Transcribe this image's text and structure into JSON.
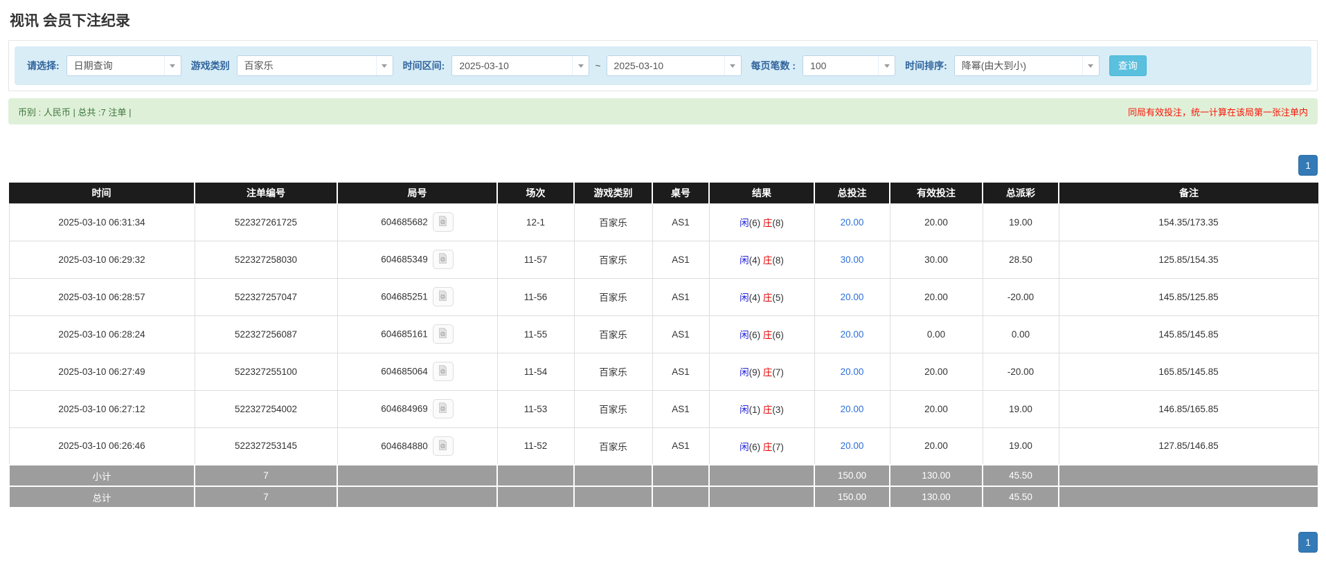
{
  "page": {
    "title": "视讯 会员下注纪录"
  },
  "filters": {
    "query_type": {
      "label": "请选择:",
      "value": "日期查询"
    },
    "game_type": {
      "label": "游戏类别",
      "value": "百家乐"
    },
    "date_range": {
      "label": "时间区间:",
      "from": "2025-03-10",
      "separator": "~",
      "to": "2025-03-10"
    },
    "page_size": {
      "label": "每页笔数 :",
      "value": "100"
    },
    "time_sort": {
      "label": "时间排序:",
      "value": "降幂(由大到小)"
    },
    "search_button": "查询"
  },
  "summary_bar": {
    "left": "币别 : 人民币 | 总共 :7 注单 |",
    "right": "同局有效投注，统一计算在该局第一张注单内"
  },
  "pagination": {
    "current_page": "1"
  },
  "table": {
    "columns": [
      {
        "key": "time",
        "label": "时间"
      },
      {
        "key": "bet_id",
        "label": "注单编号"
      },
      {
        "key": "round_id",
        "label": "局号"
      },
      {
        "key": "session",
        "label": "场次"
      },
      {
        "key": "game_type",
        "label": "游戏类别"
      },
      {
        "key": "table_id",
        "label": "桌号"
      },
      {
        "key": "result",
        "label": "结果"
      },
      {
        "key": "total_bet",
        "label": "总投注"
      },
      {
        "key": "valid_bet",
        "label": "有效投注"
      },
      {
        "key": "payout",
        "label": "总派彩"
      },
      {
        "key": "remark",
        "label": "备注"
      }
    ],
    "result_labels": {
      "player": "闲",
      "banker": "庄"
    },
    "rows": [
      {
        "time": "2025-03-10 06:31:34",
        "bet_id": "522327261725",
        "round_id": "604685682",
        "session": "12-1",
        "game_type": "百家乐",
        "table_id": "AS1",
        "result": {
          "player": "6",
          "banker": "8"
        },
        "total_bet": "20.00",
        "valid_bet": "20.00",
        "payout": "19.00",
        "remark": "154.35/173.35"
      },
      {
        "time": "2025-03-10 06:29:32",
        "bet_id": "522327258030",
        "round_id": "604685349",
        "session": "11-57",
        "game_type": "百家乐",
        "table_id": "AS1",
        "result": {
          "player": "4",
          "banker": "8"
        },
        "total_bet": "30.00",
        "valid_bet": "30.00",
        "payout": "28.50",
        "remark": "125.85/154.35"
      },
      {
        "time": "2025-03-10 06:28:57",
        "bet_id": "522327257047",
        "round_id": "604685251",
        "session": "11-56",
        "game_type": "百家乐",
        "table_id": "AS1",
        "result": {
          "player": "4",
          "banker": "5"
        },
        "total_bet": "20.00",
        "valid_bet": "20.00",
        "payout": "-20.00",
        "remark": "145.85/125.85"
      },
      {
        "time": "2025-03-10 06:28:24",
        "bet_id": "522327256087",
        "round_id": "604685161",
        "session": "11-55",
        "game_type": "百家乐",
        "table_id": "AS1",
        "result": {
          "player": "6",
          "banker": "6"
        },
        "total_bet": "20.00",
        "valid_bet": "0.00",
        "payout": "0.00",
        "remark": "145.85/145.85"
      },
      {
        "time": "2025-03-10 06:27:49",
        "bet_id": "522327255100",
        "round_id": "604685064",
        "session": "11-54",
        "game_type": "百家乐",
        "table_id": "AS1",
        "result": {
          "player": "9",
          "banker": "7"
        },
        "total_bet": "20.00",
        "valid_bet": "20.00",
        "payout": "-20.00",
        "remark": "165.85/145.85"
      },
      {
        "time": "2025-03-10 06:27:12",
        "bet_id": "522327254002",
        "round_id": "604684969",
        "session": "11-53",
        "game_type": "百家乐",
        "table_id": "AS1",
        "result": {
          "player": "1",
          "banker": "3"
        },
        "total_bet": "20.00",
        "valid_bet": "20.00",
        "payout": "19.00",
        "remark": "146.85/165.85"
      },
      {
        "time": "2025-03-10 06:26:46",
        "bet_id": "522327253145",
        "round_id": "604684880",
        "session": "11-52",
        "game_type": "百家乐",
        "table_id": "AS1",
        "result": {
          "player": "6",
          "banker": "7"
        },
        "total_bet": "20.00",
        "valid_bet": "20.00",
        "payout": "19.00",
        "remark": "127.85/146.85"
      }
    ],
    "footer_rows": [
      {
        "label": "小计",
        "count": "7",
        "total_bet": "150.00",
        "valid_bet": "130.00",
        "payout": "45.50"
      },
      {
        "label": "总计",
        "count": "7",
        "total_bet": "150.00",
        "valid_bet": "130.00",
        "payout": "45.50"
      }
    ]
  },
  "colors": {
    "accent_blue": "#5bc0de",
    "filter_bar_bg": "#d9edf7",
    "summary_bar_bg": "#dff0d8",
    "summary_text_green": "#3c763d",
    "note_red": "#fb1408",
    "pager_blue": "#337ab7",
    "header_bg": "#1c1c1c",
    "footer_bg": "#9d9d9d",
    "link_blue": "#2a6fdb",
    "player_blue": "#2222dd",
    "banker_red": "#e60000",
    "negative_red": "#ff0000"
  }
}
